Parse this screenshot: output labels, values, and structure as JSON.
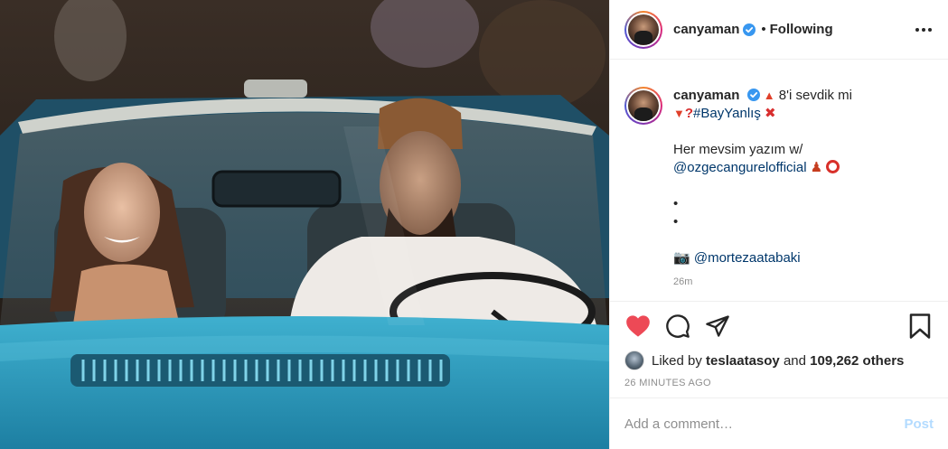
{
  "post": {
    "image_alt_icon": "photo-convertible-car"
  },
  "header": {
    "username": "canyaman",
    "separator": "•",
    "follow_status": "Following",
    "more_icon": "more-horizontal-icon"
  },
  "caption": {
    "username": "canyaman",
    "line1_text": "8'i sevdik mi",
    "line2_hashtag": "#BayYanlış",
    "line3_text": "Her mevsim yazım w/",
    "line4_mention": "@ozgecangurelofficial",
    "bullet1": "•",
    "bullet2": "•",
    "camera_emoji": "📷",
    "photo_credit": "@mortezaatabaki",
    "partial_time": "26m"
  },
  "actions": {
    "like_icon": "heart-filled-icon",
    "comment_icon": "comment-icon",
    "share_icon": "share-icon",
    "save_icon": "bookmark-icon"
  },
  "likes": {
    "prefix": "Liked by",
    "user": "teslaatasoy",
    "and": "and",
    "count": "109,262 others"
  },
  "timestamp": "26 MINUTES AGO",
  "comment": {
    "placeholder": "Add a comment…",
    "post_label": "Post"
  },
  "colors": {
    "like_red": "#ed4956",
    "mention_blue": "#00376b",
    "verified_blue": "#3897f0",
    "post_disabled": "#b3dbff"
  }
}
